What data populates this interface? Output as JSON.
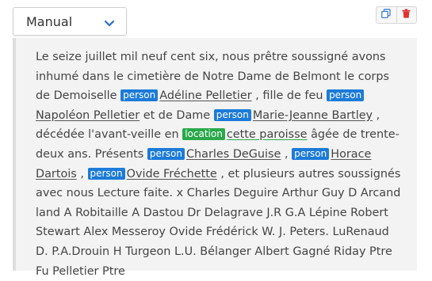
{
  "mode_select": {
    "value": "Manual"
  },
  "toolbar": {
    "copy_icon": "copy-icon",
    "delete_icon": "trash-icon"
  },
  "colors": {
    "person": "#1c7bd8",
    "location": "#2aa84a",
    "delete": "#e03030",
    "copy": "#3d7fd6"
  },
  "text": {
    "t1": "Le seize juillet mil neuf cent six, nous prêtre soussigné avons inhumé dans le cimetière de Notre Dame de Belmont le corps de Demoiselle",
    "e1_tag": "person",
    "e1": "Adéline Pelletier",
    "t2": ", fille de feu",
    "e2_tag": "person",
    "e2": "Napoléon Pelletier",
    "t3": "et de Dame",
    "e3_tag": "person",
    "e3": "Marie-Jeanne Bartley",
    "t4": ", décédée l'avant-veille en",
    "e4_tag": "location",
    "e4": "cette paroisse",
    "t5": "âgée de trente- deux ans. Présents",
    "e5_tag": "person",
    "e5": "Charles DeGuise",
    "t6": ",",
    "e6_tag": "person",
    "e6": "Horace Dartois",
    "t7": ",",
    "e7_tag": "person",
    "e7": "Ovide Fréchette",
    "t8": ", et plusieurs autres soussignés avec nous Lecture faite. x Charles Deguire Arthur Guy D Arcand land A Robitaille A Dastou Dr Delagrave J.R G.A Lépine Robert Stewart Alex Messeroy Ovide Frédérick W. J. Peters. LuRenaud D. P.A.Drouin H Turgeon L.U. Bélanger Albert Gagné Riday Ptre Fu Pelletier Ptre"
  }
}
